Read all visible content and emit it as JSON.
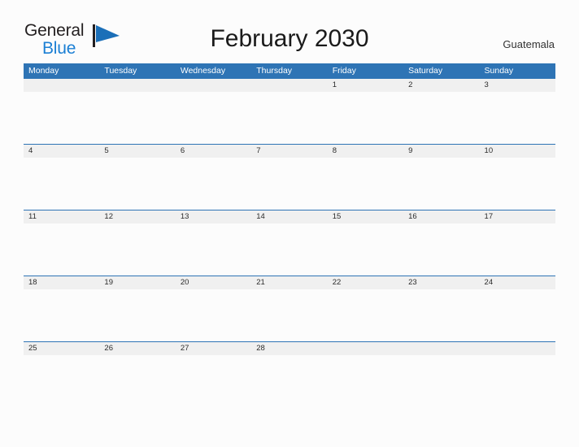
{
  "brand": {
    "name_part1": "General",
    "name_part2": "Blue",
    "flag_icon": "flag-triangle-icon",
    "accent_color": "#1b7fd4"
  },
  "header": {
    "title": "February 2030",
    "country": "Guatemala"
  },
  "theme": {
    "header_blue": "#2e74b5",
    "date_band_gray": "#f0f0f0",
    "page_background": "#fcfcfc",
    "text_dark": "#1a1a1a"
  },
  "calendar": {
    "month": "February",
    "year": "2030",
    "weekday_headers": [
      "Monday",
      "Tuesday",
      "Wednesday",
      "Thursday",
      "Friday",
      "Saturday",
      "Sunday"
    ],
    "weeks": [
      [
        "",
        "",
        "",
        "",
        "1",
        "2",
        "3"
      ],
      [
        "4",
        "5",
        "6",
        "7",
        "8",
        "9",
        "10"
      ],
      [
        "11",
        "12",
        "13",
        "14",
        "15",
        "16",
        "17"
      ],
      [
        "18",
        "19",
        "20",
        "21",
        "22",
        "23",
        "24"
      ],
      [
        "25",
        "26",
        "27",
        "28",
        "",
        "",
        ""
      ]
    ]
  }
}
